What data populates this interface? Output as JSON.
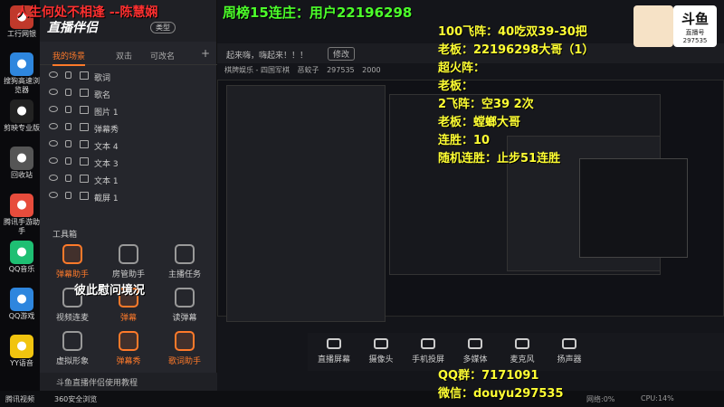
{
  "overlay": {
    "title_left": "人生何处不相逢 --陈慧娴",
    "title_right": "周榜15连庄：用户22196298",
    "right_lines": [
      "100飞阵：40吃双39-30把",
      "老板：22196298大哥（1）",
      "超火阵：",
      "老板：",
      "2飞阵：空39 2次",
      "老板：螳螂大哥",
      "连胜：10",
      "随机连胜：止步51连胜"
    ],
    "qq": "QQ群：7171091",
    "wechat": "微信：douyu297535",
    "middle_text": "彼此慰问境况"
  },
  "logo": {
    "brand": "斗鱼",
    "sub": "直播号",
    "room": "297535"
  },
  "desktop_icons": [
    {
      "label": "工行网银",
      "icon": "bank-icon",
      "color": "#c0392b"
    },
    {
      "label": "搜狗高速浏览器",
      "icon": "browser-icon",
      "color": "#2e86de"
    },
    {
      "label": "剪映专业版",
      "icon": "capcut-icon",
      "color": "#222"
    },
    {
      "label": "回收站",
      "icon": "recycle-bin-icon",
      "color": "#555"
    },
    {
      "label": "腾讯手游助手",
      "icon": "game-assist-icon",
      "color": "#e74c3c"
    },
    {
      "label": "QQ音乐",
      "icon": "qq-music-icon",
      "color": "#1ebf73"
    },
    {
      "label": "QQ游戏",
      "icon": "qq-game-icon",
      "color": "#2e86de"
    },
    {
      "label": "YY语音",
      "icon": "yy-icon",
      "color": "#f1c40f"
    }
  ],
  "panel": {
    "app_name": "直播伴侣",
    "mode": "类型",
    "tabs": [
      "我的场景",
      "双击",
      "可改名"
    ],
    "add": "+",
    "sources": [
      "歌词",
      "歌名",
      "图片 1",
      "弹幕秀",
      "文本 4",
      "文本 3",
      "文本 1",
      "截屏 1"
    ],
    "toolbox_title": "工具箱",
    "tools": [
      {
        "label": "弹幕助手",
        "hot": true
      },
      {
        "label": "房管助手",
        "hot": false
      },
      {
        "label": "主播任务",
        "hot": false
      },
      {
        "label": "视频连麦",
        "hot": false
      },
      {
        "label": "弹幕",
        "hot": true
      },
      {
        "label": "读弹幕",
        "hot": false
      },
      {
        "label": "虚拟形象",
        "hot": false
      },
      {
        "label": "弹幕秀",
        "hot": true
      },
      {
        "label": "歌词助手",
        "hot": true
      }
    ],
    "footer": "斗鱼直播伴侣使用教程"
  },
  "topbar": {
    "announce": "起来嗨，嗨起来！！！",
    "edit": "修改",
    "category": "棋牌娱乐 - 四国军棋",
    "streamer": "恶蛟子",
    "room_no": "297535",
    "fans": "2000"
  },
  "controls": [
    "直播屏幕",
    "摄像头",
    "手机投屏",
    "多媒体",
    "麦克风",
    "扬声器"
  ],
  "status": {
    "cpu": "CPU:14%",
    "network": "网络:0%"
  },
  "taskbar": [
    "腾讯视频",
    "360安全浏览"
  ]
}
